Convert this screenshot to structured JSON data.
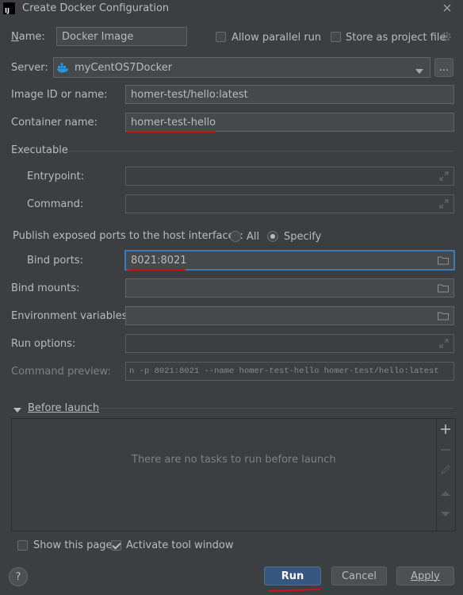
{
  "window": {
    "title": "Create Docker Configuration",
    "app_badge": "IJ"
  },
  "name": {
    "label": "Name:",
    "value": "Docker Image"
  },
  "allow_parallel": {
    "label": "Allow parallel run",
    "checked": false
  },
  "store_as_file": {
    "label": "Store as project file",
    "checked": false
  },
  "server": {
    "label": "Server:",
    "value": "myCentOS7Docker",
    "more_label": "..."
  },
  "image": {
    "label": "Image ID or name:",
    "value": "homer-test/hello:latest"
  },
  "container": {
    "label": "Container name:",
    "value": "homer-test-hello"
  },
  "executable": {
    "label": "Executable",
    "entrypoint_label": "Entrypoint:",
    "entrypoint_value": "",
    "command_label": "Command:",
    "command_value": ""
  },
  "publish": {
    "label": "Publish exposed ports to the host interfaces:",
    "option_all": "All",
    "option_specify": "Specify",
    "selected": "Specify"
  },
  "bind_ports": {
    "label": "Bind ports:",
    "value": "8021:8021"
  },
  "bind_mounts": {
    "label": "Bind mounts:",
    "value": ""
  },
  "env_vars": {
    "label": "Environment variables:",
    "value": ""
  },
  "run_options": {
    "label": "Run options:",
    "value": ""
  },
  "preview": {
    "label": "Command preview:",
    "value": "n -p 8021:8021 --name homer-test-hello homer-test/hello:latest"
  },
  "before_launch": {
    "label": "Before launch",
    "empty_text": "There are no tasks to run before launch"
  },
  "show_page": {
    "label": "Show this page",
    "checked": false
  },
  "activate_tool": {
    "label": "Activate tool window",
    "checked": true
  },
  "buttons": {
    "help": "?",
    "run": "Run",
    "cancel": "Cancel",
    "apply": "Apply"
  },
  "colors": {
    "background": "#3c3f41",
    "field": "#45494a",
    "accent": "#365880",
    "annotation": "#d0101a",
    "docker": "#2496ed"
  }
}
